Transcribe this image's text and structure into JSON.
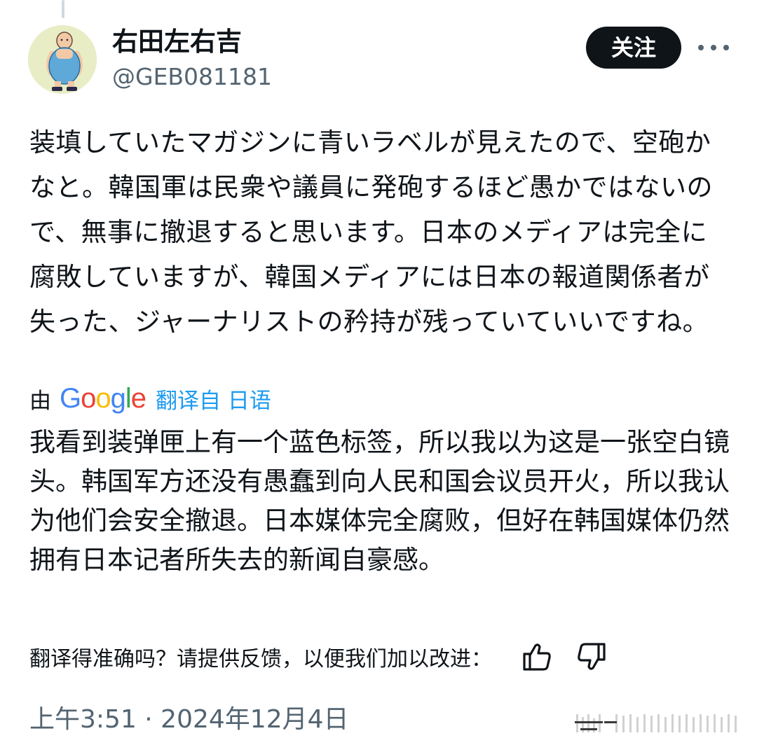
{
  "author": {
    "display_name": "右田左右吉",
    "handle": "@GEB081181",
    "avatar_icon": "cartoon-avatar"
  },
  "header": {
    "follow_label": "关注",
    "more_icon": "more-horizontal-icon"
  },
  "tweet": {
    "original_text": "装填していたマガジンに青いラベルが見えたので、空砲かなと。韓国軍は民衆や議員に発砲するほど愚かではないので、無事に撤退すると思います。日本のメディアは完全に腐敗していますが、韓国メディアには日本の報道関係者が失った、ジャーナリストの矜持が残っていていいですね。",
    "translated_by_prefix": "由",
    "translated_by_service": "Google",
    "translate_link": "翻译自 日语",
    "translated_text": "我看到装弹匣上有一个蓝色标签，所以我以为这是一张空白镜头。韩国军方还没有愚蠢到向人民和国会议员开火，所以我认为他们会安全撤退。日本媒体完全腐败，但好在韩国媒体仍然拥有日本记者所失去的新闻自豪感。"
  },
  "feedback": {
    "prompt": "翻译得准确吗？请提供反馈，以便我们加以改进：",
    "thumbs_up_icon": "thumbs-up-icon",
    "thumbs_down_icon": "thumbs-down-icon"
  },
  "meta": {
    "timestamp": "上午3:51 · 2024年12月4日"
  },
  "colors": {
    "text": "#0f1419",
    "secondary": "#536471",
    "link": "#1d9bf0",
    "button_bg": "#0f1419",
    "google_blue": "#4285f4",
    "google_red": "#ea4335",
    "google_yellow": "#fbbc05",
    "google_green": "#34a853"
  }
}
